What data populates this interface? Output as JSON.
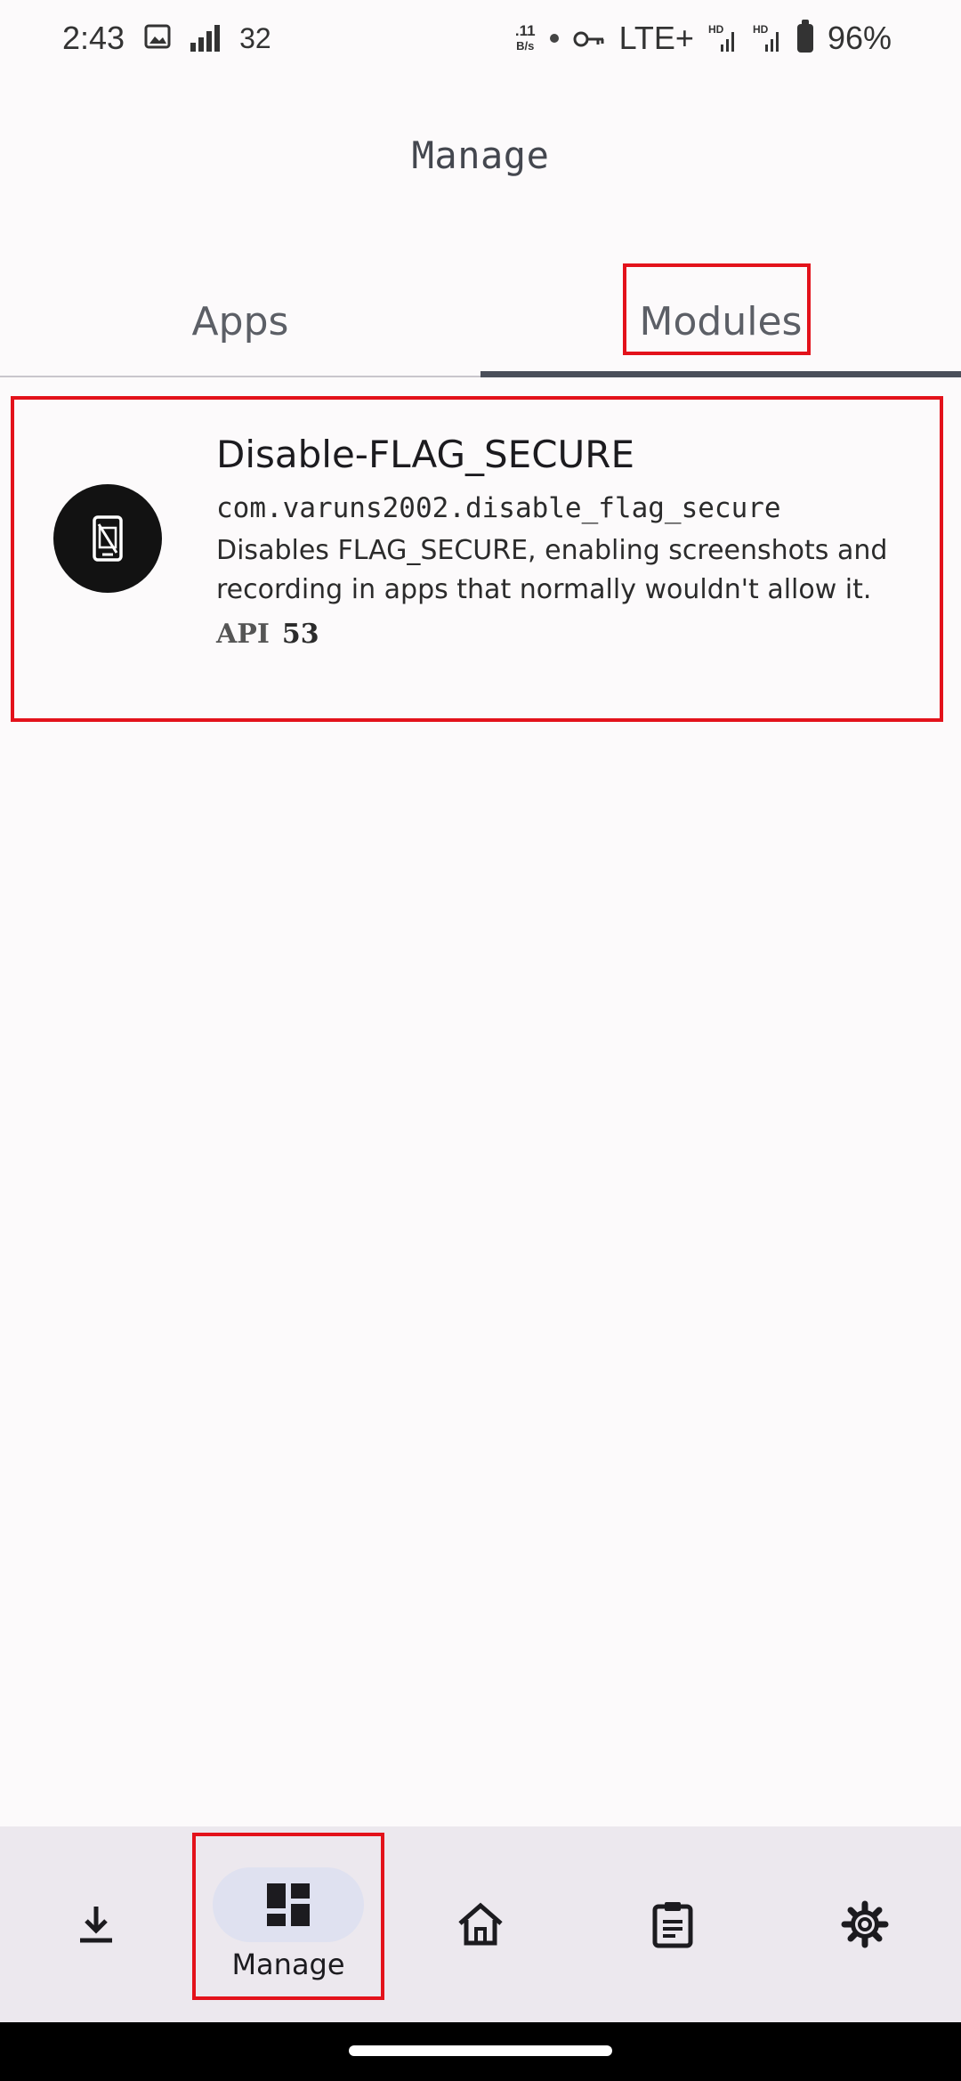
{
  "status_bar": {
    "time": "2:43",
    "notification_count": "32",
    "net_speed_value": ".11",
    "net_speed_unit": "B/s",
    "network": "LTE+",
    "hd_label_1": "HD",
    "hd_label_2": "HD",
    "battery": "96%"
  },
  "header": {
    "title": "Manage"
  },
  "tabs": [
    {
      "label": "Apps",
      "selected": false
    },
    {
      "label": "Modules",
      "selected": true
    }
  ],
  "modules": [
    {
      "name": "Disable-FLAG_SECURE",
      "package": "com.varuns2002.disable_flag_secure",
      "description": "Disables FLAG_SECURE, enabling screenshots and recording in apps that normally wouldn't allow it.",
      "api_label": "API",
      "api_value": "53",
      "icon": "screenshot-blocked-icon"
    }
  ],
  "bottom_nav": {
    "items": [
      {
        "icon": "download-icon",
        "label": ""
      },
      {
        "icon": "dashboard-icon",
        "label": "Manage",
        "selected": true
      },
      {
        "icon": "home-icon",
        "label": ""
      },
      {
        "icon": "clipboard-icon",
        "label": ""
      },
      {
        "icon": "gear-icon",
        "label": ""
      }
    ]
  },
  "colors": {
    "highlight": "#e3121b",
    "tab_indicator": "#4a4f5a",
    "nav_selected_pill": "#dfe1f0"
  }
}
